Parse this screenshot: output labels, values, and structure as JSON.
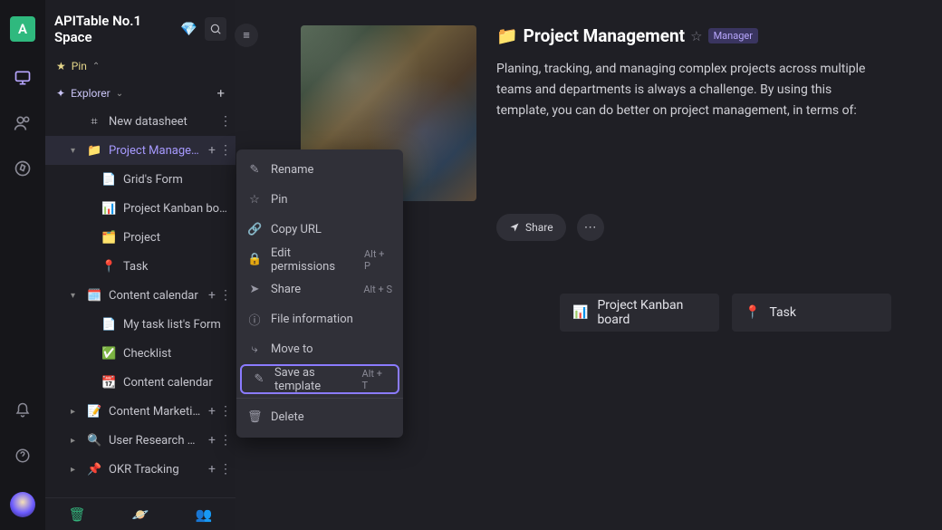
{
  "rail": {
    "avatar_letter": "A"
  },
  "space": {
    "title": "APITable No.1 Space",
    "gem": "💎"
  },
  "pin": {
    "label": "Pin"
  },
  "explorer": {
    "label": "Explorer"
  },
  "tree": {
    "new_datasheet": "New datasheet",
    "items": [
      {
        "caret": "▾",
        "icon": "📁",
        "label": "Project Management",
        "selected": true,
        "depth": 1,
        "has_add": true,
        "has_more": true
      },
      {
        "caret": "",
        "icon": "📄",
        "label": "Grid's Form",
        "depth": 2
      },
      {
        "caret": "",
        "icon": "📊",
        "label": "Project Kanban board",
        "depth": 2
      },
      {
        "caret": "",
        "icon": "🗂️",
        "label": "Project",
        "depth": 2
      },
      {
        "caret": "",
        "icon": "📍",
        "label": "Task",
        "depth": 2
      },
      {
        "caret": "▾",
        "icon": "🗓️",
        "label": "Content calendar",
        "depth": 1,
        "has_add": true,
        "has_more": true
      },
      {
        "caret": "",
        "icon": "📄",
        "label": "My task list's Form",
        "depth": 2
      },
      {
        "caret": "",
        "icon": "✅",
        "label": "Checklist",
        "depth": 2
      },
      {
        "caret": "",
        "icon": "📆",
        "label": "Content calendar",
        "depth": 2
      },
      {
        "caret": "▸",
        "icon": "📝",
        "label": "Content Marketing for SEO",
        "depth": 1,
        "has_add": true,
        "has_more": true
      },
      {
        "caret": "▸",
        "icon": "🔍",
        "label": "User Research Manageme...",
        "depth": 1,
        "has_add": true,
        "has_more": true
      },
      {
        "caret": "▸",
        "icon": "📌",
        "label": "OKR Tracking",
        "depth": 1,
        "has_add": true,
        "has_more": true
      }
    ]
  },
  "main": {
    "title_icon": "📁",
    "title": "Project Management",
    "role": "Manager",
    "description": "Planing, tracking, and managing complex projects across multiple teams and departments is always a challenge. By using this template, you can do better on project management, in terms of:",
    "share_label": "Share"
  },
  "cards": [
    {
      "icon": "📊",
      "label": "Project Kanban board"
    },
    {
      "icon": "📍",
      "label": "Task"
    }
  ],
  "ctx": {
    "rename": "Rename",
    "pin": "Pin",
    "copy_url": "Copy URL",
    "edit_permissions": "Edit permissions",
    "edit_permissions_key": "Alt + P",
    "share": "Share",
    "share_key": "Alt + S",
    "file_information": "File information",
    "move_to": "Move to",
    "save_template": "Save as template",
    "save_template_key": "Alt + T",
    "delete": "Delete"
  }
}
